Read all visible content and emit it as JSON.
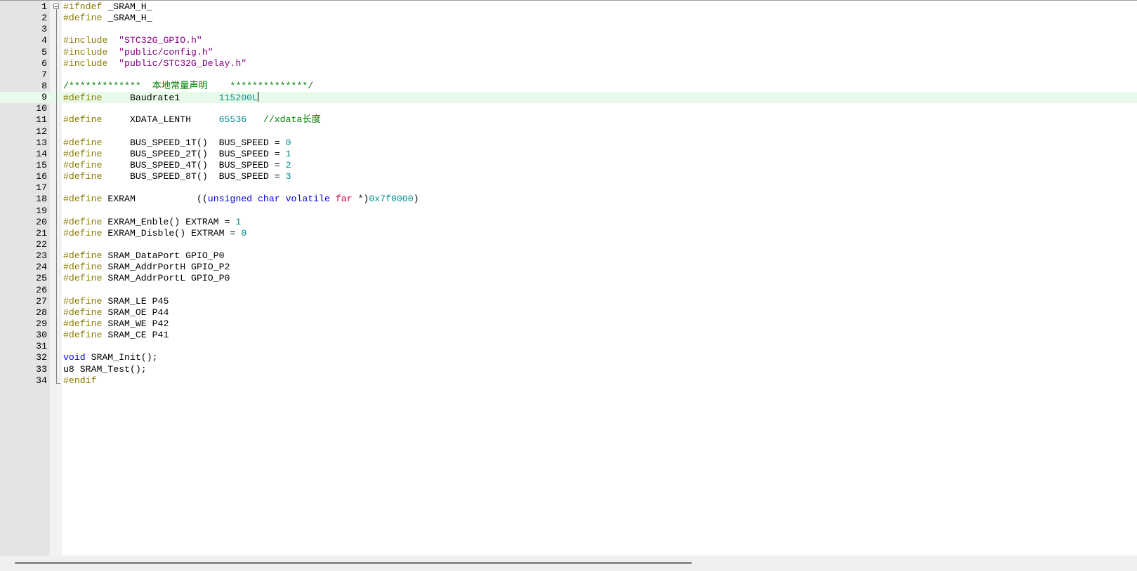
{
  "editor": {
    "current_line": 9,
    "lines": [
      {
        "n": "1",
        "tokens": [
          {
            "t": "#ifndef",
            "c": "pp"
          },
          {
            "t": " _SRAM_H_",
            "c": ""
          }
        ]
      },
      {
        "n": "2",
        "tokens": [
          {
            "t": "#define",
            "c": "pp"
          },
          {
            "t": " _SRAM_H_",
            "c": ""
          }
        ]
      },
      {
        "n": "3",
        "tokens": []
      },
      {
        "n": "4",
        "tokens": [
          {
            "t": "#include",
            "c": "pp"
          },
          {
            "t": "  \"STC32G_GPIO.h\"",
            "c": "str"
          }
        ]
      },
      {
        "n": "5",
        "tokens": [
          {
            "t": "#include",
            "c": "pp"
          },
          {
            "t": "  \"public/config.h\"",
            "c": "str"
          }
        ]
      },
      {
        "n": "6",
        "tokens": [
          {
            "t": "#include",
            "c": "pp"
          },
          {
            "t": "  \"public/STC32G_Delay.h\"",
            "c": "str"
          }
        ]
      },
      {
        "n": "7",
        "tokens": []
      },
      {
        "n": "8",
        "tokens": [
          {
            "t": "/*************  本地常量声明    **************/",
            "c": "cm"
          }
        ]
      },
      {
        "n": "9",
        "tokens": [
          {
            "t": "#define",
            "c": "pp"
          },
          {
            "t": "     Baudrate1       ",
            "c": ""
          },
          {
            "t": "115200L",
            "c": "num"
          }
        ]
      },
      {
        "n": "10",
        "tokens": []
      },
      {
        "n": "11",
        "tokens": [
          {
            "t": "#define",
            "c": "pp"
          },
          {
            "t": "     XDATA_LENTH     ",
            "c": ""
          },
          {
            "t": "65536",
            "c": "num"
          },
          {
            "t": "   //xdata长度",
            "c": "cm"
          }
        ]
      },
      {
        "n": "12",
        "tokens": []
      },
      {
        "n": "13",
        "tokens": [
          {
            "t": "#define",
            "c": "pp"
          },
          {
            "t": "     BUS_SPEED_1T()  BUS_SPEED = ",
            "c": ""
          },
          {
            "t": "0",
            "c": "num"
          }
        ]
      },
      {
        "n": "14",
        "tokens": [
          {
            "t": "#define",
            "c": "pp"
          },
          {
            "t": "     BUS_SPEED_2T()  BUS_SPEED = ",
            "c": ""
          },
          {
            "t": "1",
            "c": "num"
          }
        ]
      },
      {
        "n": "15",
        "tokens": [
          {
            "t": "#define",
            "c": "pp"
          },
          {
            "t": "     BUS_SPEED_4T()  BUS_SPEED = ",
            "c": ""
          },
          {
            "t": "2",
            "c": "num"
          }
        ]
      },
      {
        "n": "16",
        "tokens": [
          {
            "t": "#define",
            "c": "pp"
          },
          {
            "t": "     BUS_SPEED_8T()  BUS_SPEED = ",
            "c": ""
          },
          {
            "t": "3",
            "c": "num"
          }
        ]
      },
      {
        "n": "17",
        "tokens": []
      },
      {
        "n": "18",
        "tokens": [
          {
            "t": "#define",
            "c": "pp"
          },
          {
            "t": " EXRAM           ((",
            "c": ""
          },
          {
            "t": "unsigned char volatile",
            "c": "kw"
          },
          {
            "t": " ",
            "c": ""
          },
          {
            "t": "far",
            "c": "red"
          },
          {
            "t": " *)",
            "c": ""
          },
          {
            "t": "0x7f0000",
            "c": "num"
          },
          {
            "t": ")",
            "c": ""
          }
        ]
      },
      {
        "n": "19",
        "tokens": []
      },
      {
        "n": "20",
        "tokens": [
          {
            "t": "#define",
            "c": "pp"
          },
          {
            "t": " EXRAM_Enble() EXTRAM = ",
            "c": ""
          },
          {
            "t": "1",
            "c": "num"
          }
        ]
      },
      {
        "n": "21",
        "tokens": [
          {
            "t": "#define",
            "c": "pp"
          },
          {
            "t": " EXRAM_Disble() EXTRAM = ",
            "c": ""
          },
          {
            "t": "0",
            "c": "num"
          }
        ]
      },
      {
        "n": "22",
        "tokens": []
      },
      {
        "n": "23",
        "tokens": [
          {
            "t": "#define",
            "c": "pp"
          },
          {
            "t": " SRAM_DataPort GPIO_P0",
            "c": ""
          }
        ]
      },
      {
        "n": "24",
        "tokens": [
          {
            "t": "#define",
            "c": "pp"
          },
          {
            "t": " SRAM_AddrPortH GPIO_P2",
            "c": ""
          }
        ]
      },
      {
        "n": "25",
        "tokens": [
          {
            "t": "#define",
            "c": "pp"
          },
          {
            "t": " SRAM_AddrPortL GPIO_P0",
            "c": ""
          }
        ]
      },
      {
        "n": "26",
        "tokens": []
      },
      {
        "n": "27",
        "tokens": [
          {
            "t": "#define",
            "c": "pp"
          },
          {
            "t": " SRAM_LE P45",
            "c": ""
          }
        ]
      },
      {
        "n": "28",
        "tokens": [
          {
            "t": "#define",
            "c": "pp"
          },
          {
            "t": " SRAM_OE P44",
            "c": ""
          }
        ]
      },
      {
        "n": "29",
        "tokens": [
          {
            "t": "#define",
            "c": "pp"
          },
          {
            "t": " SRAM_WE P42",
            "c": ""
          }
        ]
      },
      {
        "n": "30",
        "tokens": [
          {
            "t": "#define",
            "c": "pp"
          },
          {
            "t": " SRAM_CE P41",
            "c": ""
          }
        ]
      },
      {
        "n": "31",
        "tokens": []
      },
      {
        "n": "32",
        "tokens": [
          {
            "t": "void",
            "c": "kw"
          },
          {
            "t": " SRAM_Init();",
            "c": ""
          }
        ]
      },
      {
        "n": "33",
        "tokens": [
          {
            "t": "u8 SRAM_Test();",
            "c": ""
          }
        ]
      },
      {
        "n": "34",
        "tokens": [
          {
            "t": "#endif",
            "c": "pp"
          }
        ]
      }
    ]
  },
  "colors": {
    "preprocessor": "#8a7a00",
    "keyword": "#0000e0",
    "far_keyword": "#c8004a",
    "number": "#008c8c",
    "string": "#800080",
    "comment": "#008000",
    "current_line_bg": "#e8fbe8"
  },
  "icons": {
    "fold_open": "fold-minus-icon"
  }
}
